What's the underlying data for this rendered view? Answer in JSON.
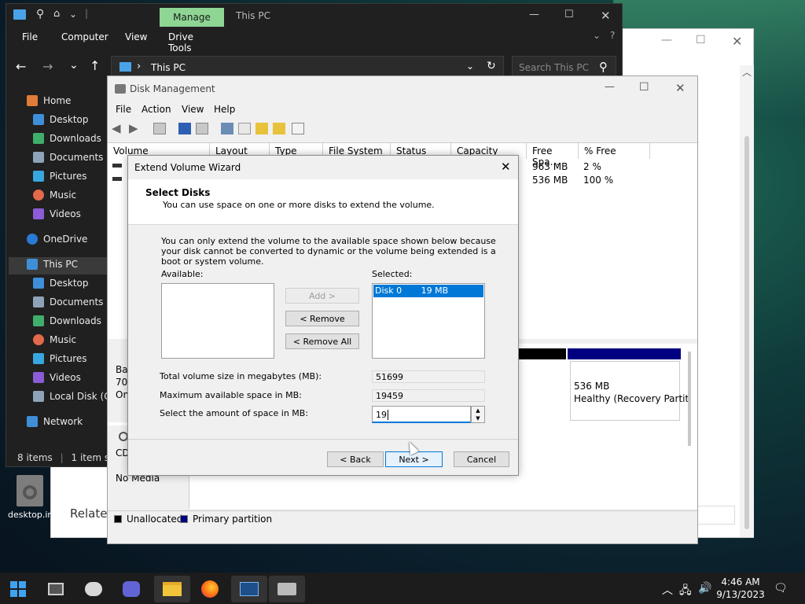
{
  "explorer": {
    "manage_tab": "Manage",
    "title": "This PC",
    "menu": [
      "File",
      "Computer",
      "View",
      "Drive Tools"
    ],
    "address": "This PC",
    "search_placeholder": "Search This PC",
    "sidebar": [
      {
        "label": "Home",
        "color": "#e07b39"
      },
      {
        "label": "Desktop",
        "color": "#3f8fd8"
      },
      {
        "label": "Downloads",
        "color": "#3fae6a"
      },
      {
        "label": "Documents",
        "color": "#8ea3b8"
      },
      {
        "label": "Pictures",
        "color": "#38a7e0"
      },
      {
        "label": "Music",
        "color": "#e26a4a"
      },
      {
        "label": "Videos",
        "color": "#8b5cd6"
      },
      {
        "label": "OneDrive",
        "color": "#2a7ad6"
      },
      {
        "label": "This PC",
        "color": "#3f8fd8"
      },
      {
        "label": "Desktop",
        "color": "#3f8fd8"
      },
      {
        "label": "Documents",
        "color": "#8ea3b8"
      },
      {
        "label": "Downloads",
        "color": "#3fae6a"
      },
      {
        "label": "Music",
        "color": "#e26a4a"
      },
      {
        "label": "Pictures",
        "color": "#38a7e0"
      },
      {
        "label": "Videos",
        "color": "#8b5cd6"
      },
      {
        "label": "Local Disk (C:)",
        "color": "#8ea3b8"
      },
      {
        "label": "Network",
        "color": "#3f8fd8"
      }
    ],
    "status_items": "8 items",
    "status_selected": "1 item sele"
  },
  "disk_mgmt": {
    "title": "Disk Management",
    "menu": [
      "File",
      "Action",
      "View",
      "Help"
    ],
    "columns": [
      "Volume",
      "Layout",
      "Type",
      "File System",
      "Status",
      "Capacity",
      "Free Spa...",
      "% Free"
    ],
    "rows": [
      {
        "free": "963 MB",
        "pct": "2 %"
      },
      {
        "free": "536 MB",
        "pct": "100 %"
      }
    ],
    "disk_label_1": "Bas",
    "disk_label_2": "70.",
    "disk_label_3": "On",
    "cd_label": "CD",
    "no_media": "No Media",
    "recovery_size": "536 MB",
    "recovery_status": "Healthy (Recovery Partiti",
    "legend_unallocated": "Unallocated",
    "legend_primary": "Primary partition"
  },
  "wizard": {
    "title": "Extend Volume Wizard",
    "heading": "Select Disks",
    "subheading": "You can use space on one or more disks to extend the volume.",
    "description": "You can only extend the volume to the available space shown below because your disk cannot be converted to dynamic or the volume being extended is a boot or system volume.",
    "available_label": "Available:",
    "selected_label": "Selected:",
    "selected_item": "Disk 0       19 MB",
    "add_button": "Add >",
    "remove_button": "< Remove",
    "remove_all_button": "< Remove All",
    "total_label": "Total volume size in megabytes (MB):",
    "total_value": "51699",
    "max_label": "Maximum available space in MB:",
    "max_value": "19459",
    "amount_label": "Select the amount of space in MB:",
    "amount_value": "19",
    "back_button": "< Back",
    "next_button": "Next >",
    "cancel_button": "Cancel"
  },
  "desktop": {
    "icon_label": "desktop.in",
    "related": "Relate"
  },
  "taskbar": {
    "time": "4:46 AM",
    "date": "9/13/2023"
  }
}
